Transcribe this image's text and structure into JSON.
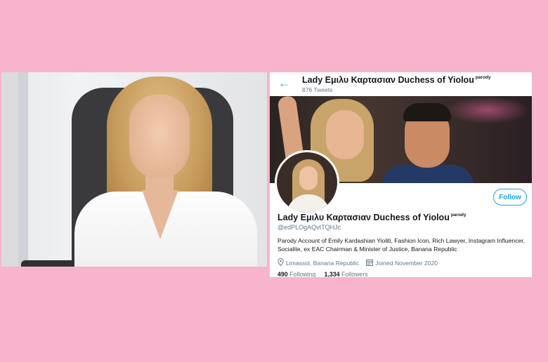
{
  "profile": {
    "display_name": "Lady Εμιλυ Καρτασιαν Duchess of Yiolou",
    "label": "parody",
    "tweet_count": "876 Tweets",
    "handle": "@edPLOgAQvtTQHJc",
    "bio": "Parody Account of Emily Kardashian Yioliti, Fashion Icon, Rich Lawyer, Instagram Influencer, Socialite,  ex EAC Chairman & Minister of Justice, Banana Republic",
    "location": "Limassol, Banana Republic",
    "joined": "Joined November 2020",
    "following_count": "490",
    "following_label": "Following",
    "followers_count": "1,334",
    "followers_label": "Followers",
    "follow_button": "Follow"
  },
  "icons": {
    "back": "back-arrow-icon",
    "location": "location-pin-icon",
    "calendar": "calendar-icon"
  },
  "colors": {
    "background": "#f8b4cc",
    "accent": "#1da1f2"
  }
}
